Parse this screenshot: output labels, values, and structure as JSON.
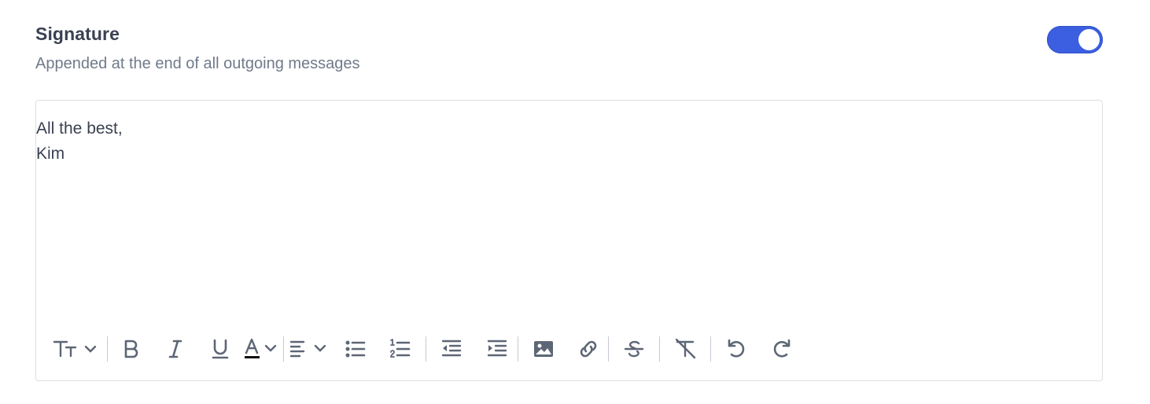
{
  "header": {
    "title": "Signature",
    "subtitle": "Appended at the end of all outgoing messages"
  },
  "toggle": {
    "state": "on",
    "accent_color": "#3b5fe0"
  },
  "editor": {
    "lines": [
      "All the best,",
      "Kim"
    ]
  },
  "toolbar": {
    "buttons": [
      "font-size-icon",
      "bold-icon",
      "italic-icon",
      "underline-icon",
      "text-color-icon",
      "align-icon",
      "bulleted-list-icon",
      "numbered-list-icon",
      "outdent-icon",
      "indent-icon",
      "image-icon",
      "link-icon",
      "strikethrough-icon",
      "clear-formatting-icon",
      "undo-icon",
      "redo-icon"
    ]
  }
}
